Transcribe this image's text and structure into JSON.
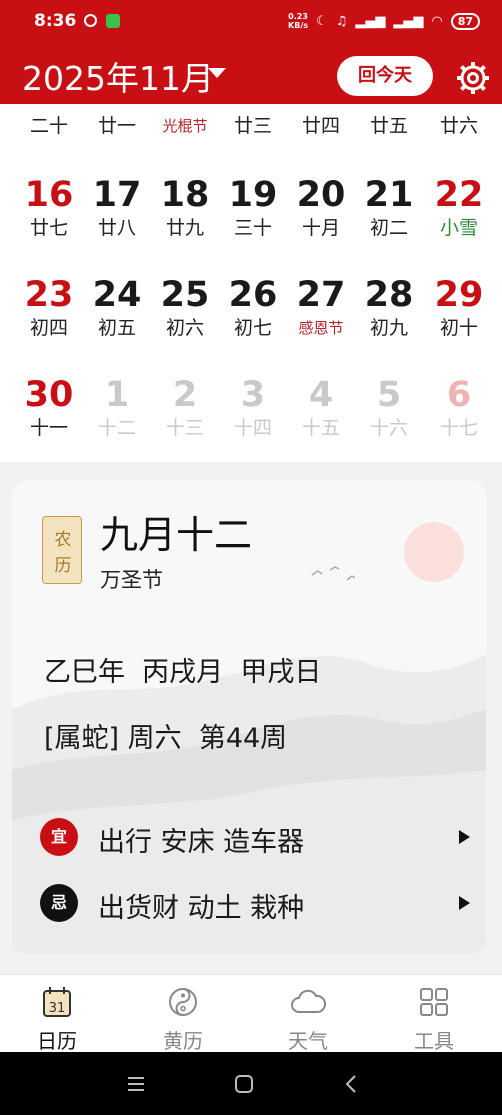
{
  "status": {
    "time": "8:36",
    "speed_top": "0.23",
    "speed_bottom": "KB/s",
    "battery": "87"
  },
  "header": {
    "month_title": "2025年11月",
    "today_button": "回今天"
  },
  "calendar": {
    "partial_row": [
      "二十",
      "廿一",
      "光棍节",
      "廿三",
      "廿四",
      "廿五",
      "廿六"
    ],
    "week3": [
      {
        "d": "16",
        "l": "廿七"
      },
      {
        "d": "17",
        "l": "廿八"
      },
      {
        "d": "18",
        "l": "廿九"
      },
      {
        "d": "19",
        "l": "三十"
      },
      {
        "d": "20",
        "l": "十月"
      },
      {
        "d": "21",
        "l": "初二"
      },
      {
        "d": "22",
        "l": "小雪"
      }
    ],
    "week4": [
      {
        "d": "23",
        "l": "初四"
      },
      {
        "d": "24",
        "l": "初五"
      },
      {
        "d": "25",
        "l": "初六"
      },
      {
        "d": "26",
        "l": "初七"
      },
      {
        "d": "27",
        "l": "感恩节"
      },
      {
        "d": "28",
        "l": "初九"
      },
      {
        "d": "29",
        "l": "初十"
      }
    ],
    "week5": [
      {
        "d": "30",
        "l": "十一"
      },
      {
        "d": "1",
        "l": "十二"
      },
      {
        "d": "2",
        "l": "十三"
      },
      {
        "d": "3",
        "l": "十四"
      },
      {
        "d": "4",
        "l": "十五"
      },
      {
        "d": "5",
        "l": "十六"
      },
      {
        "d": "6",
        "l": "十七"
      }
    ]
  },
  "detail": {
    "seal_top": "农",
    "seal_bottom": "历",
    "lunar_date": "九月十二",
    "festival": "万圣节",
    "ganzhi": "乙巳年  丙戌月  甲戌日",
    "zodiac_line": "[属蛇] 周六  第44周",
    "yi_badge": "宜",
    "yi_text": "出行 安床 造车器",
    "ji_badge": "忌",
    "ji_text": "出货财 动土 栽种"
  },
  "nav": {
    "calendar_num": "31",
    "items": [
      "日历",
      "黄历",
      "天气",
      "工具"
    ]
  },
  "colors": {
    "brand_red": "#c70f14",
    "term_green": "#2f8a3a"
  }
}
